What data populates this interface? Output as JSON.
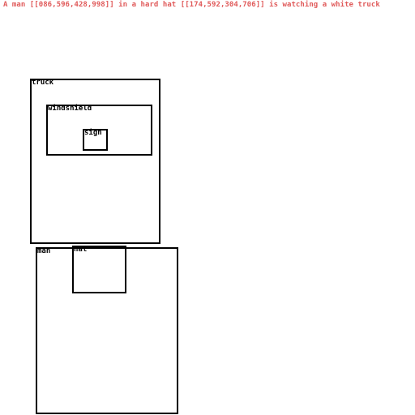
{
  "caption": "A man [[086,596,428,998]] in a hard hat [[174,592,304,706]] is watching a white truck",
  "colors": {
    "caption": "#e05a5a",
    "box_border": "#000000",
    "background": "#ffffff"
  },
  "labels": {
    "truck": "truck",
    "windshield": "windshield",
    "sign": "sign",
    "man": "man",
    "hat": "hat"
  }
}
